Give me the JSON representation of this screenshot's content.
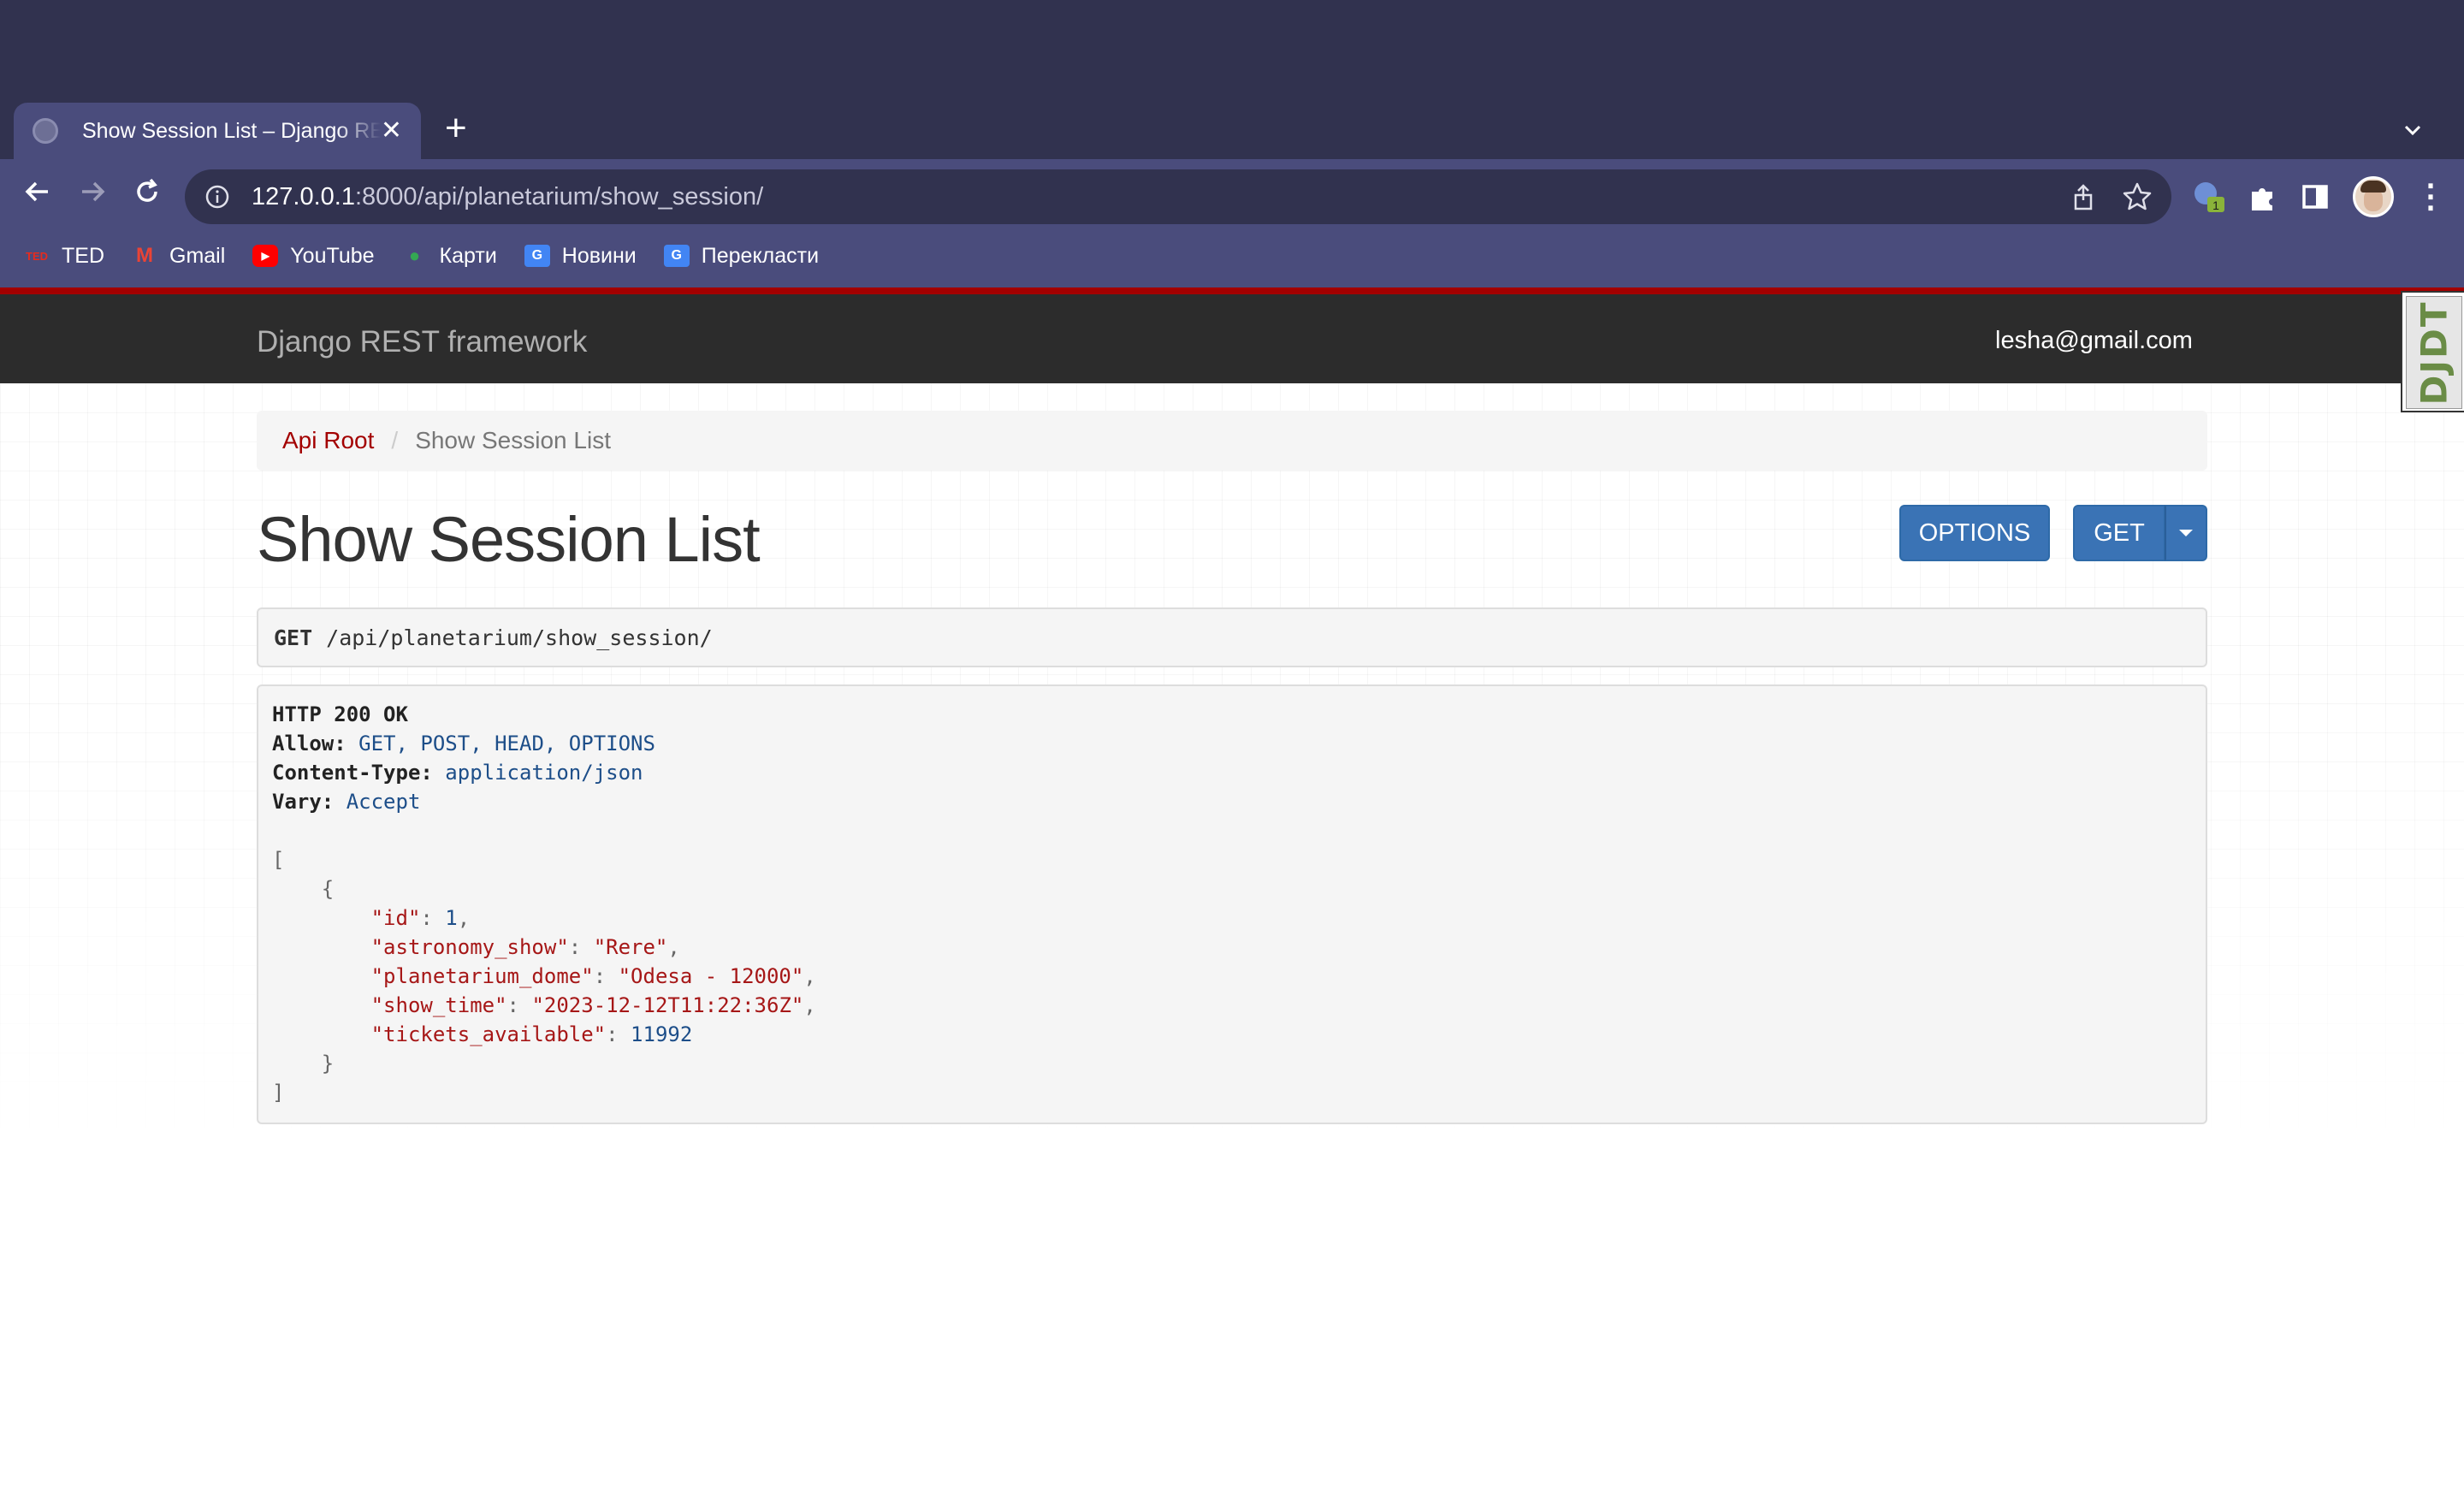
{
  "browser": {
    "tab": {
      "title": "Show Session List – Django REST framework"
    },
    "omnibox": {
      "host": "127.0.0.1",
      "rest": ":8000/api/planetarium/show_session/"
    },
    "extension_badge": "1",
    "bookmarks": [
      {
        "label": "TED",
        "icon": "ted-icon",
        "icon_text": "TED",
        "color": "#e62b1e"
      },
      {
        "label": "Gmail",
        "icon": "gmail-icon",
        "icon_text": "M",
        "color": "#ea4335"
      },
      {
        "label": "YouTube",
        "icon": "youtube-icon",
        "icon_text": "▶",
        "color": "#ff0000"
      },
      {
        "label": "Карти",
        "icon": "maps-icon",
        "icon_text": "●",
        "color": "#34a853"
      },
      {
        "label": "Новини",
        "icon": "news-icon",
        "icon_text": "G",
        "color": "#4285f4"
      },
      {
        "label": "Перекласти",
        "icon": "translate-icon",
        "icon_text": "G",
        "color": "#4285f4"
      }
    ]
  },
  "navbar": {
    "brand": "Django REST framework",
    "user": "lesha@gmail.com",
    "debug_toolbar": "DJDT"
  },
  "breadcrumb": {
    "root": "Api Root",
    "separator": "/",
    "current": "Show Session List"
  },
  "page": {
    "title": "Show Session List",
    "options_label": "OPTIONS",
    "get_label": "GET"
  },
  "request": {
    "method": "GET",
    "url": "/api/planetarium/show_session/"
  },
  "response": {
    "status": "HTTP 200 OK",
    "headers": [
      {
        "name": "Allow:",
        "value": "GET, POST, HEAD, OPTIONS"
      },
      {
        "name": "Content-Type:",
        "value": "application/json"
      },
      {
        "name": "Vary:",
        "value": "Accept"
      }
    ],
    "body": {
      "open_bracket": "[",
      "open_brace": "{",
      "fields": [
        {
          "key": "\"id\"",
          "value": "1",
          "type": "number",
          "comma": ","
        },
        {
          "key": "\"astronomy_show\"",
          "value": "\"Rere\"",
          "type": "string",
          "comma": ","
        },
        {
          "key": "\"planetarium_dome\"",
          "value": "\"Odesa - 12000\"",
          "type": "string",
          "comma": ","
        },
        {
          "key": "\"show_time\"",
          "value": "\"2023-12-12T11:22:36Z\"",
          "type": "string",
          "comma": ","
        },
        {
          "key": "\"tickets_available\"",
          "value": "11992",
          "type": "number",
          "comma": ""
        }
      ],
      "close_brace": "}",
      "close_bracket": "]"
    }
  },
  "colors": {
    "accent_red": "#a30000",
    "button_blue": "#3a73b5",
    "navbar_dark": "#2c2c2c",
    "chrome_bg": "#31324f"
  }
}
